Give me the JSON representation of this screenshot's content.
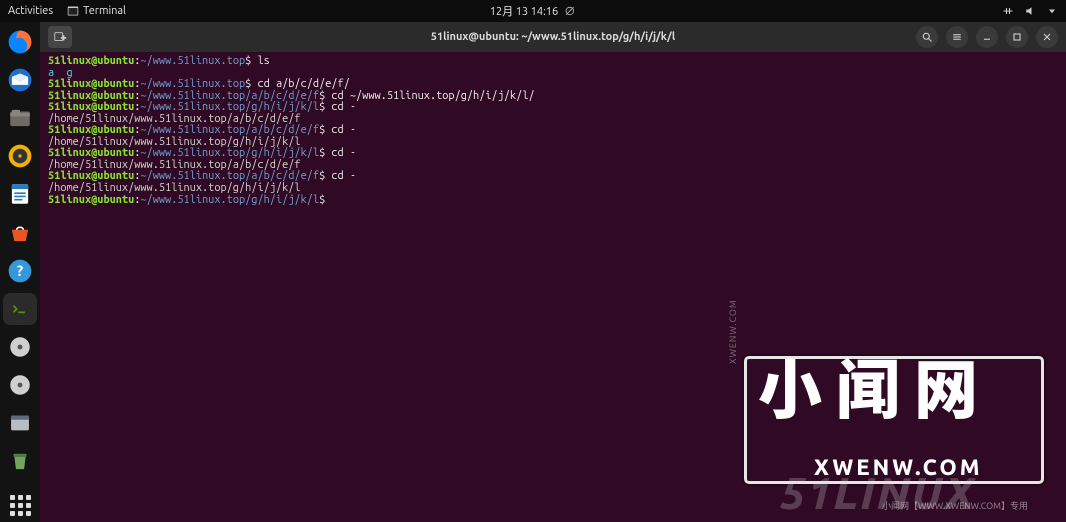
{
  "topbar": {
    "activities": "Activities",
    "active_app": "Terminal",
    "clock": "12月 13  14:16"
  },
  "dock": {
    "items": [
      {
        "name": "firefox"
      },
      {
        "name": "thunderbird"
      },
      {
        "name": "files"
      },
      {
        "name": "rhythmbox"
      },
      {
        "name": "libreoffice-writer"
      },
      {
        "name": "ubuntu-software"
      },
      {
        "name": "help"
      },
      {
        "name": "terminal"
      },
      {
        "name": "disc1"
      },
      {
        "name": "disc2"
      },
      {
        "name": "settings-panel"
      },
      {
        "name": "trash"
      }
    ]
  },
  "window": {
    "title": "51linux@ubuntu: ~/www.51linux.top/g/h/i/j/k/l"
  },
  "terminal": {
    "lines": [
      {
        "u": "51linux@ubuntu",
        "p": "~/www.51linux.top",
        "c": "ls"
      },
      {
        "out_dirs": "a  g"
      },
      {
        "u": "51linux@ubuntu",
        "p": "~/www.51linux.top",
        "c": "cd a/b/c/d/e/f/"
      },
      {
        "u": "51linux@ubuntu",
        "p": "~/www.51linux.top/a/b/c/d/e/f",
        "c": "cd ~/www.51linux.top/g/h/i/j/k/l/"
      },
      {
        "u": "51linux@ubuntu",
        "p": "~/www.51linux.top/g/h/i/j/k/l",
        "c": "cd -"
      },
      {
        "out": "/home/51linux/www.51linux.top/a/b/c/d/e/f"
      },
      {
        "u": "51linux@ubuntu",
        "p": "~/www.51linux.top/a/b/c/d/e/f",
        "c": "cd -"
      },
      {
        "out": "/home/51linux/www.51linux.top/g/h/i/j/k/l"
      },
      {
        "u": "51linux@ubuntu",
        "p": "~/www.51linux.top/g/h/i/j/k/l",
        "c": "cd -"
      },
      {
        "out": "/home/51linux/www.51linux.top/a/b/c/d/e/f"
      },
      {
        "u": "51linux@ubuntu",
        "p": "~/www.51linux.top/a/b/c/d/e/f",
        "c": "cd -"
      },
      {
        "out": "/home/51linux/www.51linux.top/g/h/i/j/k/l"
      },
      {
        "u": "51linux@ubuntu",
        "p": "~/www.51linux.top/g/h/i/j/k/l",
        "c": ""
      }
    ]
  },
  "watermark": {
    "cn": "小闻网",
    "brand": "51LINUX",
    "en": "XWENW.COM",
    "side": "XWENW.COM",
    "foot": "小闻网【WWW.XWENW.COM】专用"
  }
}
